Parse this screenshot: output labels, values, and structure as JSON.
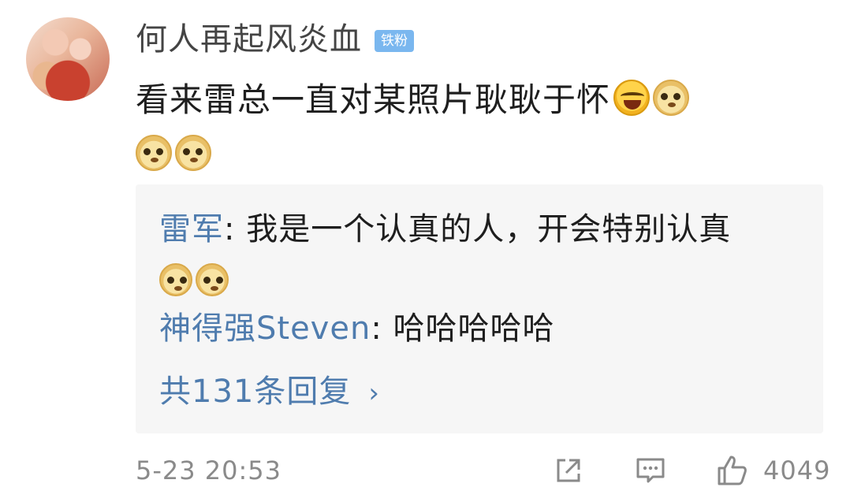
{
  "comment": {
    "username": "何人再起风炎血",
    "badge": "铁粉",
    "text": "看来雷总一直对某照片耿耿于怀",
    "icons": [
      "laugh-cry-emoji",
      "doge-emoji",
      "doge-emoji",
      "doge-emoji"
    ]
  },
  "replies": [
    {
      "author": "雷军",
      "separator": ": ",
      "text": "我是一个认真的人，开会特别认真",
      "icons": [
        "doge-emoji",
        "doge-emoji"
      ]
    },
    {
      "author": "神得强Steven",
      "separator": ": ",
      "text": "哈哈哈哈哈"
    }
  ],
  "replies_link": "共131条回复",
  "footer": {
    "timestamp": "5-23 20:53",
    "like_count": "4049",
    "icons": [
      "share-icon",
      "comment-icon",
      "like-icon"
    ]
  },
  "colors": {
    "link": "#4f7cae",
    "badge": "#7ab7ef",
    "reply_bg": "#f6f6f6",
    "meta_text": "#8a8a8a"
  }
}
